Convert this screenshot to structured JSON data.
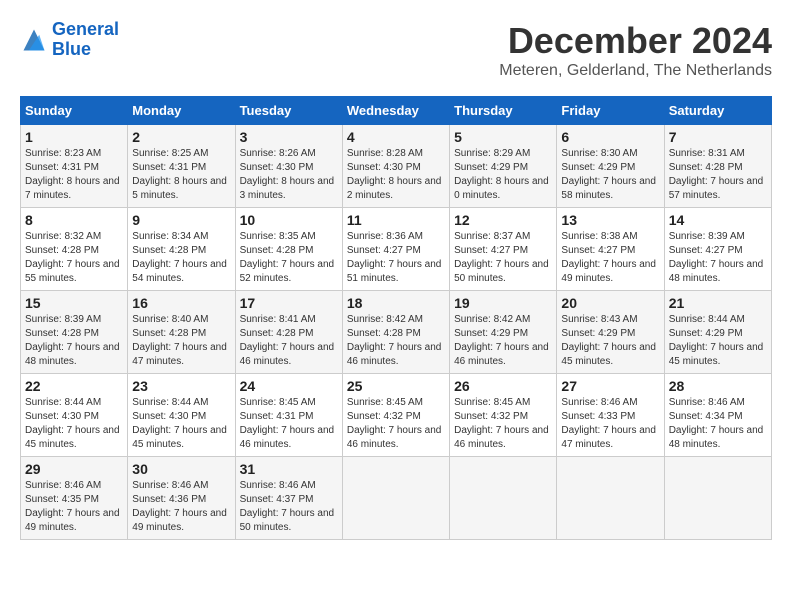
{
  "header": {
    "logo_line1": "General",
    "logo_line2": "Blue",
    "month_title": "December 2024",
    "location": "Meteren, Gelderland, The Netherlands"
  },
  "days_of_week": [
    "Sunday",
    "Monday",
    "Tuesday",
    "Wednesday",
    "Thursday",
    "Friday",
    "Saturday"
  ],
  "weeks": [
    [
      {
        "day": "1",
        "sunrise": "8:23 AM",
        "sunset": "4:31 PM",
        "daylight": "8 hours and 7 minutes."
      },
      {
        "day": "2",
        "sunrise": "8:25 AM",
        "sunset": "4:31 PM",
        "daylight": "8 hours and 5 minutes."
      },
      {
        "day": "3",
        "sunrise": "8:26 AM",
        "sunset": "4:30 PM",
        "daylight": "8 hours and 3 minutes."
      },
      {
        "day": "4",
        "sunrise": "8:28 AM",
        "sunset": "4:30 PM",
        "daylight": "8 hours and 2 minutes."
      },
      {
        "day": "5",
        "sunrise": "8:29 AM",
        "sunset": "4:29 PM",
        "daylight": "8 hours and 0 minutes."
      },
      {
        "day": "6",
        "sunrise": "8:30 AM",
        "sunset": "4:29 PM",
        "daylight": "7 hours and 58 minutes."
      },
      {
        "day": "7",
        "sunrise": "8:31 AM",
        "sunset": "4:28 PM",
        "daylight": "7 hours and 57 minutes."
      }
    ],
    [
      {
        "day": "8",
        "sunrise": "8:32 AM",
        "sunset": "4:28 PM",
        "daylight": "7 hours and 55 minutes."
      },
      {
        "day": "9",
        "sunrise": "8:34 AM",
        "sunset": "4:28 PM",
        "daylight": "7 hours and 54 minutes."
      },
      {
        "day": "10",
        "sunrise": "8:35 AM",
        "sunset": "4:28 PM",
        "daylight": "7 hours and 52 minutes."
      },
      {
        "day": "11",
        "sunrise": "8:36 AM",
        "sunset": "4:27 PM",
        "daylight": "7 hours and 51 minutes."
      },
      {
        "day": "12",
        "sunrise": "8:37 AM",
        "sunset": "4:27 PM",
        "daylight": "7 hours and 50 minutes."
      },
      {
        "day": "13",
        "sunrise": "8:38 AM",
        "sunset": "4:27 PM",
        "daylight": "7 hours and 49 minutes."
      },
      {
        "day": "14",
        "sunrise": "8:39 AM",
        "sunset": "4:27 PM",
        "daylight": "7 hours and 48 minutes."
      }
    ],
    [
      {
        "day": "15",
        "sunrise": "8:39 AM",
        "sunset": "4:28 PM",
        "daylight": "7 hours and 48 minutes."
      },
      {
        "day": "16",
        "sunrise": "8:40 AM",
        "sunset": "4:28 PM",
        "daylight": "7 hours and 47 minutes."
      },
      {
        "day": "17",
        "sunrise": "8:41 AM",
        "sunset": "4:28 PM",
        "daylight": "7 hours and 46 minutes."
      },
      {
        "day": "18",
        "sunrise": "8:42 AM",
        "sunset": "4:28 PM",
        "daylight": "7 hours and 46 minutes."
      },
      {
        "day": "19",
        "sunrise": "8:42 AM",
        "sunset": "4:29 PM",
        "daylight": "7 hours and 46 minutes."
      },
      {
        "day": "20",
        "sunrise": "8:43 AM",
        "sunset": "4:29 PM",
        "daylight": "7 hours and 45 minutes."
      },
      {
        "day": "21",
        "sunrise": "8:44 AM",
        "sunset": "4:29 PM",
        "daylight": "7 hours and 45 minutes."
      }
    ],
    [
      {
        "day": "22",
        "sunrise": "8:44 AM",
        "sunset": "4:30 PM",
        "daylight": "7 hours and 45 minutes."
      },
      {
        "day": "23",
        "sunrise": "8:44 AM",
        "sunset": "4:30 PM",
        "daylight": "7 hours and 45 minutes."
      },
      {
        "day": "24",
        "sunrise": "8:45 AM",
        "sunset": "4:31 PM",
        "daylight": "7 hours and 46 minutes."
      },
      {
        "day": "25",
        "sunrise": "8:45 AM",
        "sunset": "4:32 PM",
        "daylight": "7 hours and 46 minutes."
      },
      {
        "day": "26",
        "sunrise": "8:45 AM",
        "sunset": "4:32 PM",
        "daylight": "7 hours and 46 minutes."
      },
      {
        "day": "27",
        "sunrise": "8:46 AM",
        "sunset": "4:33 PM",
        "daylight": "7 hours and 47 minutes."
      },
      {
        "day": "28",
        "sunrise": "8:46 AM",
        "sunset": "4:34 PM",
        "daylight": "7 hours and 48 minutes."
      }
    ],
    [
      {
        "day": "29",
        "sunrise": "8:46 AM",
        "sunset": "4:35 PM",
        "daylight": "7 hours and 49 minutes."
      },
      {
        "day": "30",
        "sunrise": "8:46 AM",
        "sunset": "4:36 PM",
        "daylight": "7 hours and 49 minutes."
      },
      {
        "day": "31",
        "sunrise": "8:46 AM",
        "sunset": "4:37 PM",
        "daylight": "7 hours and 50 minutes."
      },
      null,
      null,
      null,
      null
    ]
  ]
}
